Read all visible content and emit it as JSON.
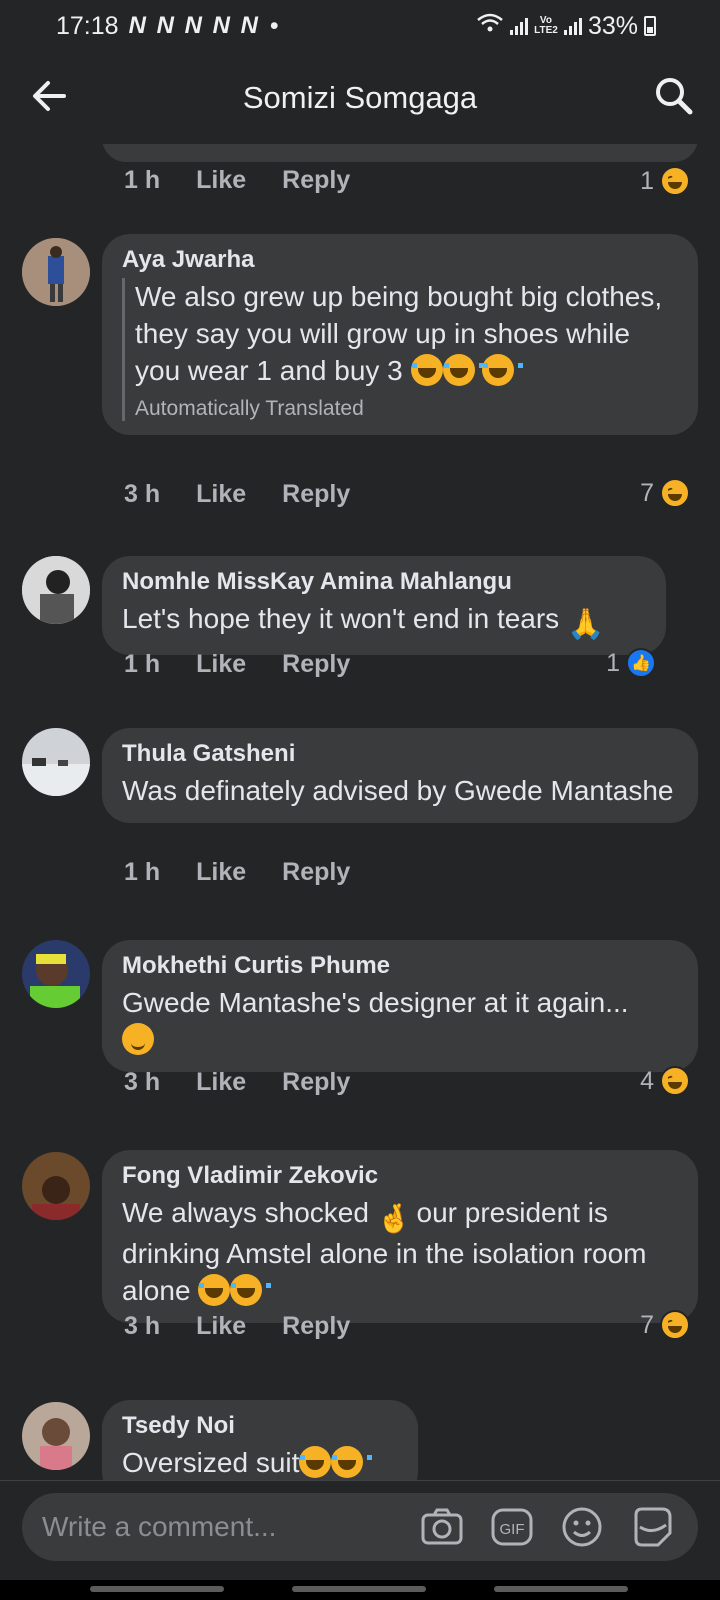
{
  "status_bar": {
    "time": "17:18",
    "notifications": "N N N N N",
    "dot": "•",
    "network_label": "Vo LTE2",
    "battery": "33%"
  },
  "header": {
    "title": "Somizi Somgaga",
    "back_icon": "back-arrow-icon",
    "search_icon": "search-icon"
  },
  "labels": {
    "like": "Like",
    "reply": "Reply",
    "translated": "Automatically Translated"
  },
  "previous_comment": {
    "time": "1 h",
    "reaction_count": "1",
    "reaction": "haha"
  },
  "comments": [
    {
      "author": "Aya Jwarha",
      "text": "We also grew up being bought big clothes, they say you will grow up in shoes while you wear 1 and buy 3",
      "time": "3 h",
      "reaction_count": "7",
      "reaction": "haha"
    },
    {
      "author": "Nomhle MissKay Amina Mahlangu",
      "text": "Let's hope they it won't end in tears",
      "time": "1 h",
      "reaction_count": "1",
      "reaction": "like"
    },
    {
      "author": "Thula Gatsheni",
      "text": "Was definately advised by Gwede Mantashe",
      "time": "1 h"
    },
    {
      "author": "Mokhethi Curtis Phume",
      "text": "Gwede Mantashe's designer at it again...",
      "time": "3 h",
      "reaction_count": "4",
      "reaction": "haha"
    },
    {
      "author": "Fong Vladimir Zekovic",
      "text_part1": "We always shocked",
      "text_part2": "our president is drinking Amstel alone in the isolation room alone",
      "time": "3 h",
      "reaction_count": "7",
      "reaction": "haha"
    },
    {
      "author": "Tsedy Noi",
      "text": "Oversized suit"
    }
  ],
  "composer": {
    "placeholder": "Write a comment...",
    "icons": [
      "camera-icon",
      "gif-icon",
      "emoji-icon",
      "sticker-icon"
    ]
  },
  "colors": {
    "background": "#242526",
    "bubble": "#3a3b3c",
    "text_primary": "#e4e6eb",
    "text_secondary": "#b0b3b8",
    "like_blue": "#1877f2",
    "haha_yellow": "#f7b125"
  }
}
